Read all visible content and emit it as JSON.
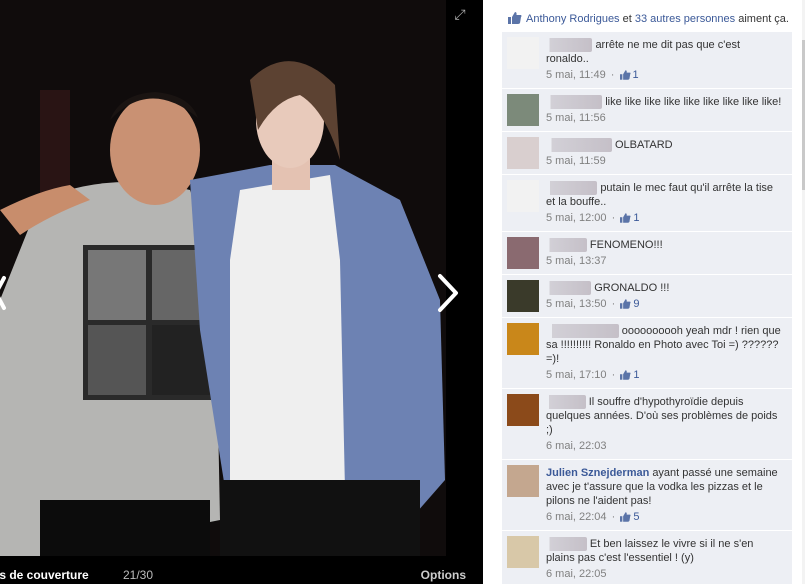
{
  "stage": {
    "album_title": "tos de couverture",
    "counter": "21/30",
    "options_label": "Options",
    "expand_icon": "expand-icon",
    "next_icon": "chevron-right-icon",
    "prev_icon": "chevron-left-icon"
  },
  "likes": {
    "icon": "thumbs-up-icon",
    "first_person": "Anthony Rodrigues",
    "connector": "et",
    "others": "33 autres personnes",
    "suffix": "aiment ça."
  },
  "comments": [
    {
      "author": "Pa·········",
      "text": "arrête ne me dit pas que c'est ronaldo..",
      "time": "5 mai, 11:49",
      "likes": "1",
      "avatar_color": "#f2f2f2"
    },
    {
      "author": "D·········vic",
      "text": "like like like like like like like like like!",
      "time": "5 mai, 11:56",
      "likes": "",
      "avatar_color": "#7c8a7a"
    },
    {
      "author": "Kozpa·········",
      "text": "OLBATARD",
      "time": "5 mai, 11:59",
      "likes": "",
      "avatar_color": "#d9cfcf"
    },
    {
      "author": "M·········ic",
      "text": "putain le mec faut qu'il arrête la tise et la bouffe..",
      "time": "5 mai, 12:00",
      "likes": "1",
      "avatar_color": "#f2f2f2"
    },
    {
      "author": "C·········",
      "text": "FENOMENO!!!",
      "time": "5 mai, 13:37",
      "likes": "",
      "avatar_color": "#8a6a70"
    },
    {
      "author": "Dr·········",
      "text": "GRONALDO !!!",
      "time": "5 mai, 13:50",
      "likes": "9",
      "avatar_color": "#3a3a2a"
    },
    {
      "author": "Angelic·········",
      "text": "oooooooooh yeah mdr ! rien que sa !!!!!!!!!! Ronaldo en Photo avec Toi =) ?????? =)!",
      "time": "5 mai, 17:10",
      "likes": "1",
      "avatar_color": "#c9871a"
    },
    {
      "author": "L·········",
      "text": "Il souffre d'hypothyroïdie depuis quelques années. D'où ses problèmes de poids ;)",
      "time": "6 mai, 22:03",
      "likes": "",
      "avatar_color": "#8b4a1a"
    },
    {
      "author": "Julien Sznejderman",
      "text": "ayant passé une semaine avec je t'assure que la vodka les pizzas et le pilons ne l'aident pas!",
      "time": "6 mai, 22:04",
      "likes": "5",
      "avatar_color": "#c4a78f"
    },
    {
      "author": "A·········",
      "text": "Et ben laissez le vivre si il ne s'en plains pas c'est l'essentiel ! (y)",
      "time": "6 mai, 22:05",
      "likes": "",
      "avatar_color": "#d8c8a8"
    }
  ],
  "colors": {
    "link_blue": "#3b5998",
    "comment_bg": "#edeff4",
    "meta_gray": "#808080",
    "stage_bg": "#000000"
  }
}
